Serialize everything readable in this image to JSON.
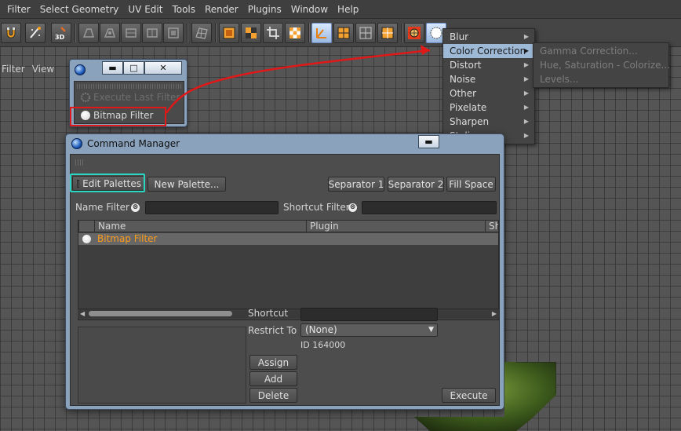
{
  "menubar": [
    "Filter",
    "Select Geometry",
    "UV Edit",
    "Tools",
    "Render",
    "Plugins",
    "Window",
    "Help"
  ],
  "toolbar": {
    "icons": [
      "magnet-icon",
      "brush-sparkle-icon",
      "paint-3d-icon",
      "uv-tool-1-icon",
      "uv-tool-2-icon",
      "uv-tool-3-icon",
      "uv-tool-4-icon",
      "uv-tool-5-icon",
      "mesh-icon",
      "layer-orange-icon",
      "checker-orange-icon",
      "crop-icon",
      "checker-icon",
      "axis-icon",
      "layer-grid-icon",
      "layer-split-icon",
      "layer-cross-icon",
      "globe-render-icon",
      "bitmap-filter-icon"
    ],
    "badge_3d": "3D"
  },
  "viewbar": [
    "Filter",
    "View"
  ],
  "palette_window": {
    "items": [
      {
        "label": "Execute Last Filter",
        "enabled": false
      },
      {
        "label": "Bitmap Filter",
        "enabled": true
      }
    ],
    "buttons": {
      "minimize": "▬",
      "maximize": "□",
      "close": "✕"
    }
  },
  "filter_menu": {
    "items": [
      {
        "label": "Blur",
        "submenu": true,
        "highlighted": false
      },
      {
        "label": "Color Correction",
        "submenu": true,
        "highlighted": true
      },
      {
        "label": "Distort",
        "submenu": true,
        "highlighted": false
      },
      {
        "label": "Noise",
        "submenu": true,
        "highlighted": false
      },
      {
        "label": "Other",
        "submenu": true,
        "highlighted": false
      },
      {
        "label": "Pixelate",
        "submenu": true,
        "highlighted": false
      },
      {
        "label": "Sharpen",
        "submenu": true,
        "highlighted": false
      },
      {
        "label": "Stylize",
        "submenu": true,
        "highlighted": false
      }
    ],
    "submenu_arrow": "▶"
  },
  "color_correction_submenu": {
    "items": [
      "Gamma Correction...",
      "Hue, Saturation - Colorize...",
      "Levels..."
    ]
  },
  "command_manager": {
    "title": "Command Manager",
    "edit_palettes": "Edit Palettes",
    "new_palette": "New Palette...",
    "separator1": "Separator 1",
    "separator2": "Separator 2",
    "fill_space": "Fill Space",
    "name_filter_label": "Name Filter",
    "shortcut_filter_label": "Shortcut Filter",
    "clear_glyph": "⊗",
    "columns": [
      "Name",
      "Plugin",
      "Sh"
    ],
    "rows": [
      {
        "name": "Bitmap Filter",
        "plugin": ""
      }
    ],
    "shortcut_label": "Shortcut",
    "restrict_to_label": "Restrict To",
    "restrict_to_value": "(None)",
    "id_text": "ID 164000",
    "assign": "Assign",
    "add": "Add",
    "delete": "Delete",
    "execute": "Execute",
    "scroll_left": "◀",
    "scroll_right": "▶",
    "dropdown_caret": "▼"
  },
  "colors": {
    "highlight_menu": "#9eb9d6",
    "annotation_red": "#e01818",
    "annotation_cyan": "#28d6c2",
    "list_item_text": "#ff9c1a",
    "window_frame": "#8aa2bb"
  }
}
